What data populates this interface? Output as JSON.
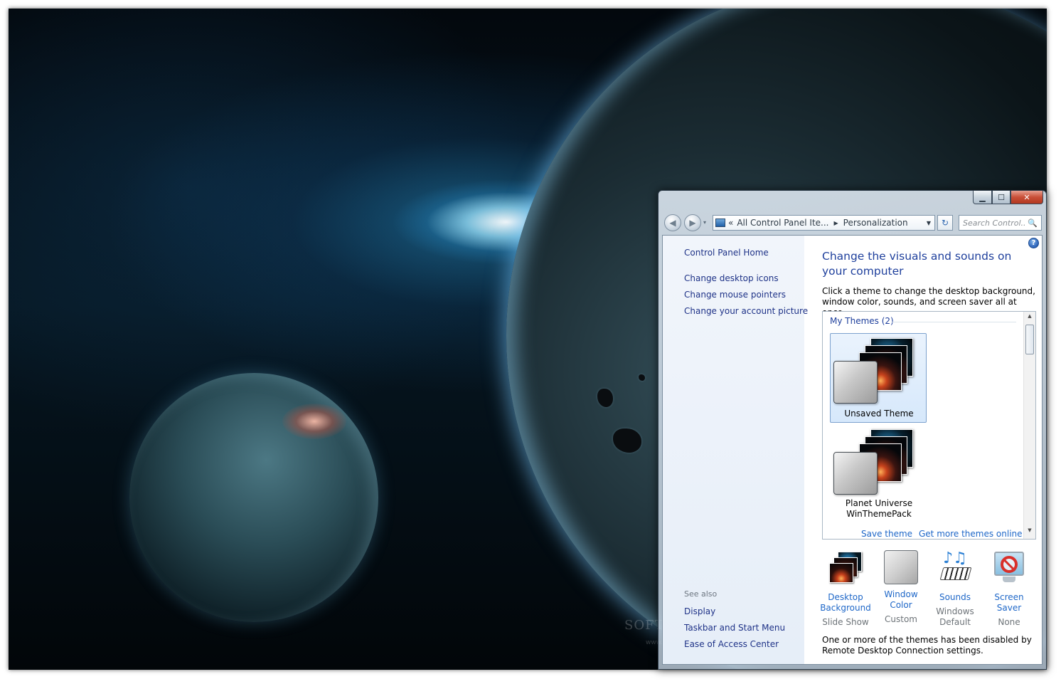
{
  "desktop": {
    "watermark": "SOFTPEDIA",
    "watermark_url": "www.softpedia.com"
  },
  "window": {
    "caption_buttons": {
      "minimize": "▁",
      "maximize": "☐",
      "close": "✕"
    },
    "navigation": {
      "back": "◀",
      "forward": "▶",
      "history_dropdown": "▾"
    },
    "address": {
      "chevrons": "«",
      "crumbs": [
        "All Control Panel Ite...",
        "Personalization"
      ],
      "separator": "▶",
      "dropdown": "▼"
    },
    "refresh_icon": "↻",
    "search": {
      "placeholder": "Search Control...",
      "icon": "🔍"
    }
  },
  "left_pane": {
    "home": "Control Panel Home",
    "tasks": [
      "Change desktop icons",
      "Change mouse pointers",
      "Change your account picture"
    ],
    "see_also_heading": "See also",
    "see_also": [
      "Display",
      "Taskbar and Start Menu",
      "Ease of Access Center"
    ]
  },
  "main": {
    "title": "Change the visuals and sounds on your computer",
    "description": "Click a theme to change the desktop background, window color, sounds, and screen saver all at once.",
    "help_icon": "?",
    "themes_group": "My Themes (2)",
    "themes": [
      {
        "name": "Unsaved Theme",
        "selected": true
      },
      {
        "name": "Planet Universe WinThemePack",
        "selected": false
      }
    ],
    "scroll": {
      "up": "▲",
      "down": "▼"
    },
    "links": {
      "save_theme": "Save theme",
      "get_more": "Get more themes online"
    },
    "settings": [
      {
        "label": "Desktop Background",
        "value": "Slide Show",
        "icon": "desktop-background-icon"
      },
      {
        "label": "Window Color",
        "value": "Custom",
        "icon": "window-color-icon"
      },
      {
        "label": "Sounds",
        "value": "Windows Default",
        "icon": "sounds-icon"
      },
      {
        "label": "Screen Saver",
        "value": "None",
        "icon": "screen-saver-icon"
      }
    ],
    "sounds_notes": "♪♫",
    "note": "One or more of the themes has been disabled by Remote Desktop Connection settings."
  },
  "colors": {
    "link": "#1e3287",
    "accent_link": "#1e67c8",
    "title": "#1e3f9c",
    "close_button": "#c94f37"
  }
}
